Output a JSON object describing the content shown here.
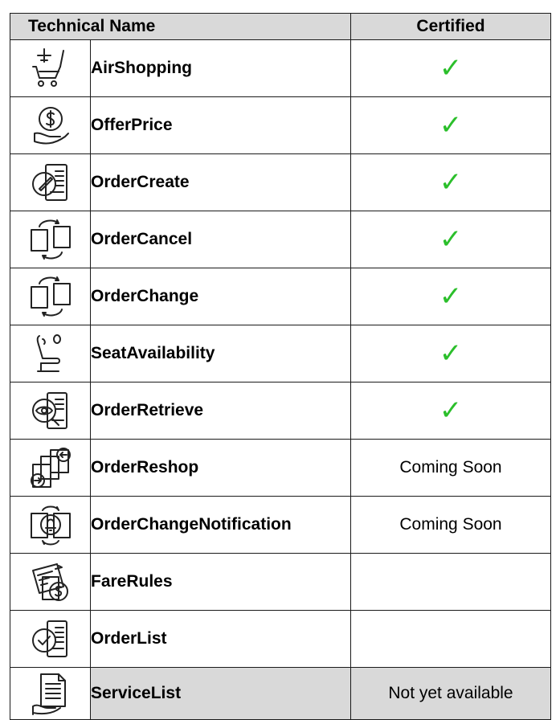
{
  "table": {
    "headers": {
      "name": "Technical Name",
      "certified": "Certified"
    },
    "check_color": "#2bbf2b",
    "rows": [
      {
        "icon": "airshopping-icon",
        "name": "AirShopping",
        "certified": true,
        "status": ""
      },
      {
        "icon": "offerprice-icon",
        "name": "OfferPrice",
        "certified": true,
        "status": ""
      },
      {
        "icon": "ordercreate-icon",
        "name": "OrderCreate",
        "certified": true,
        "status": ""
      },
      {
        "icon": "ordercancel-icon",
        "name": "OrderCancel",
        "certified": true,
        "status": ""
      },
      {
        "icon": "orderchange-icon",
        "name": "OrderChange",
        "certified": true,
        "status": ""
      },
      {
        "icon": "seatavailability-icon",
        "name": "SeatAvailability",
        "certified": true,
        "status": ""
      },
      {
        "icon": "orderretrieve-icon",
        "name": "OrderRetrieve",
        "certified": true,
        "status": ""
      },
      {
        "icon": "orderreshop-icon",
        "name": "OrderReshop",
        "certified": false,
        "status": "Coming Soon"
      },
      {
        "icon": "orderchangenotification-icon",
        "name": "OrderChangeNotification",
        "certified": false,
        "status": "Coming Soon"
      },
      {
        "icon": "farerules-icon",
        "name": "FareRules",
        "certified": false,
        "status": ""
      },
      {
        "icon": "orderlist-icon",
        "name": "OrderList",
        "certified": false,
        "status": ""
      },
      {
        "icon": "servicelist-icon",
        "name": "ServiceList",
        "certified": false,
        "status": "Not yet available"
      }
    ]
  }
}
